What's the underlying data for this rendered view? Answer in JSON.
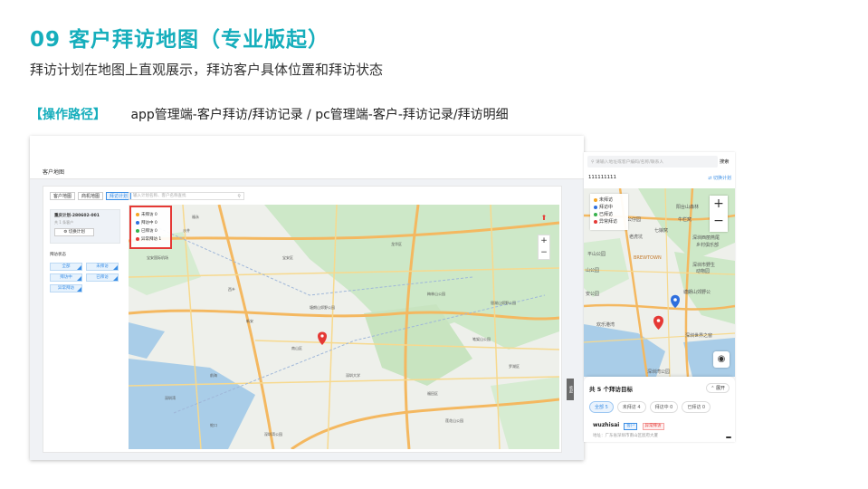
{
  "slide": {
    "title": "09  客户拜访地图（专业版起）",
    "subtitle": "拜访计划在地图上直观展示，拜访客户具体位置和拜访状态",
    "path_label": "【操作路径】",
    "path_text": "app管理端-客户拜访/拜访记录 / pc管理端-客户-拜访记录/拜访明细"
  },
  "desktop": {
    "page_name": "客户地图",
    "tabs": [
      {
        "label": "客户地图",
        "active": false
      },
      {
        "label": "商机地图",
        "active": false
      },
      {
        "label": "拜访计划",
        "active": true
      }
    ],
    "search_placeholder": "输入计划名称、客户名称查找",
    "plan": {
      "name": "重庆计划-280602-001",
      "date": "共 1 条客户",
      "switch_label": "切换计划"
    },
    "state_title": "拜访状态",
    "state_buttons": [
      "全部",
      "未拜访",
      "拜访中",
      "已拜访",
      "异常拜访"
    ],
    "legend": [
      {
        "label": "未拜访 0",
        "color": "#f5a623"
      },
      {
        "label": "拜访中 0",
        "color": "#2f6fde"
      },
      {
        "label": "已拜访 0",
        "color": "#37b24d"
      },
      {
        "label": "异常拜访 1",
        "color": "#e53935"
      }
    ],
    "zoom_in": "+",
    "zoom_out": "−",
    "side_tab": "收起"
  },
  "mobile": {
    "search_placeholder": "请输入地址或客户编码/名称/联系人",
    "search_button": "搜索",
    "plan_name": "111111111",
    "switch_label": "⇄ 切换计划",
    "legend": [
      {
        "label": "未拜访",
        "color": "#f5a623"
      },
      {
        "label": "拜访中",
        "color": "#2f6fde"
      },
      {
        "label": "已拜访",
        "color": "#37b24d"
      },
      {
        "label": "异常拜访",
        "color": "#e53935"
      }
    ],
    "zoom_in": "+",
    "zoom_out": "−",
    "locate": "◉",
    "sheet_title": "共 5 个拜访目标",
    "expand_label": "⌃ 展开",
    "chips": [
      {
        "label": "全部 5",
        "active": true
      },
      {
        "label": "未拜访 4",
        "active": false
      },
      {
        "label": "拜访中 0",
        "active": false
      },
      {
        "label": "已拜访 0",
        "active": false
      }
    ],
    "customer": {
      "name": "wuzhisai",
      "tag1": "客户",
      "tag2": "异常拜访",
      "address": "地址：广东省深圳市南山区宸府大厦"
    }
  },
  "map_labels_desktop": [
    "宝安国际机场",
    "福永",
    "沙井",
    "西乡",
    "新安",
    "南山区",
    "深圳湾",
    "蛇口",
    "宝安区",
    "龙华区",
    "福田区",
    "罗湖区",
    "塘朗山郊野公园",
    "梅林山公园",
    "银湖山郊野公园",
    "深圳大学",
    "前海",
    "笔架山公园",
    "莲花山公园",
    "深圳湾公园"
  ],
  "map_labels_mobile": [
    "阳台山森林",
    "公仔园",
    "牛栏窝",
    "七娘窝",
    "老虎坑",
    "深圳西丽燕尾",
    "乡村俱乐部",
    "BREWTOWN",
    "平山公园",
    "深圳市野生",
    "动物园",
    "山公园",
    "安公园",
    "塘朗山郊野公",
    "欢乐港湾",
    "深圳世界之窗",
    "深圳湾公园"
  ]
}
